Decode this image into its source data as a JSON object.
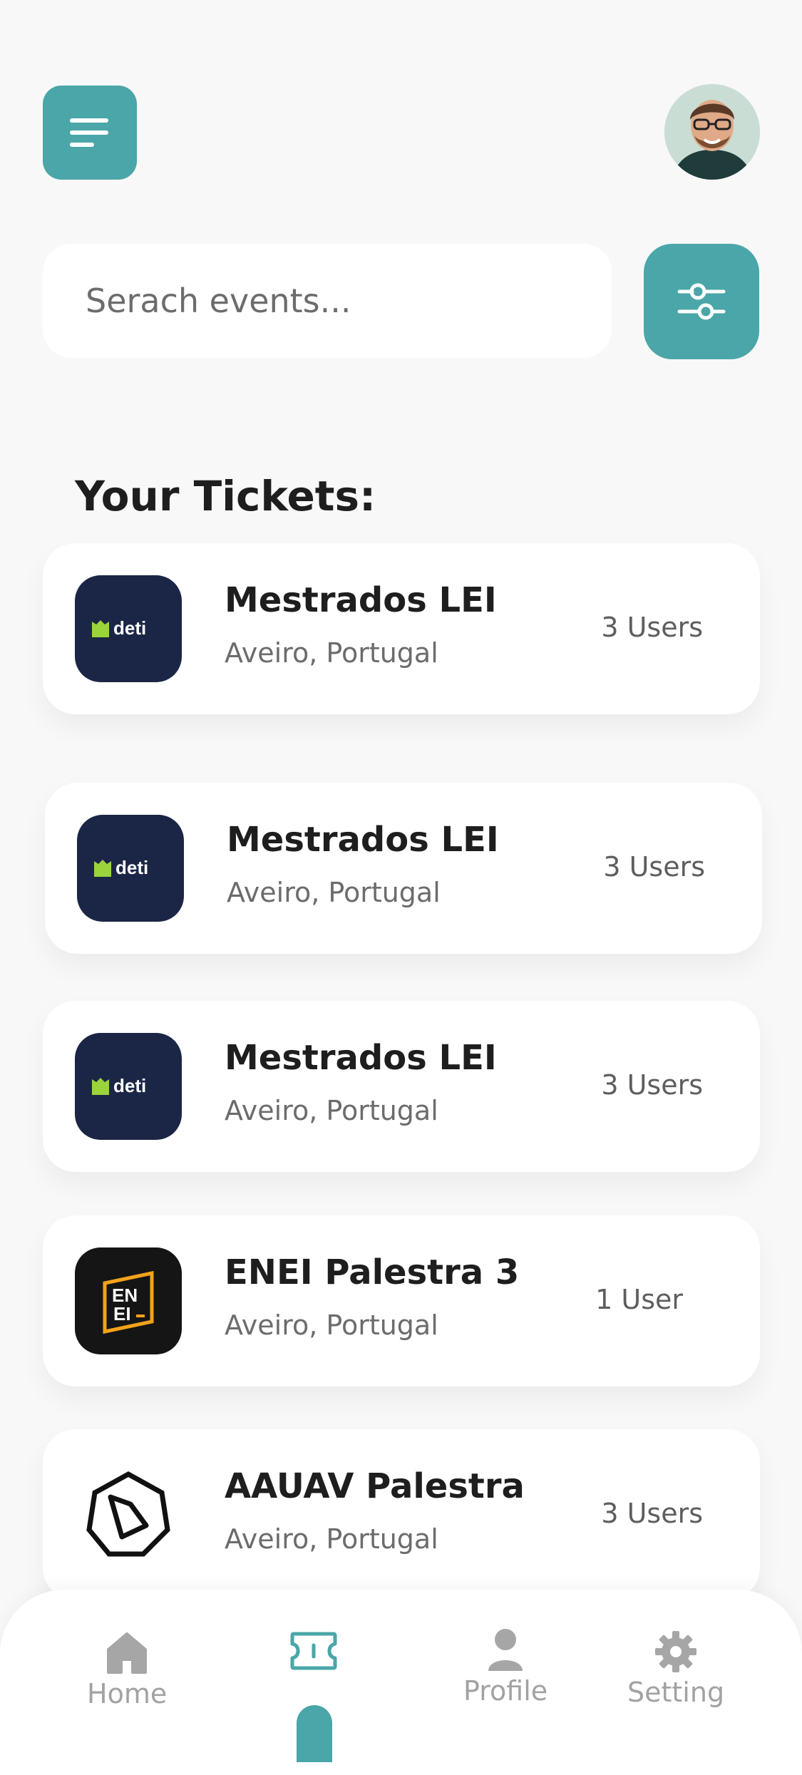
{
  "search": {
    "placeholder": "Serach events..."
  },
  "section": {
    "title": "Your Tickets:"
  },
  "colors": {
    "accent": "#4aa6a8",
    "deti_bg": "#1b2646",
    "deti_green": "#9ad43a",
    "enei_orange": "#f2a21b"
  },
  "tickets": [
    {
      "title": "Mestrados LEI",
      "location": "Aveiro, Portugal",
      "users": "3 Users",
      "logo": "deti-logo"
    },
    {
      "title": "Mestrados LEI",
      "location": "Aveiro, Portugal",
      "users": "3 Users",
      "logo": "deti-logo"
    },
    {
      "title": "Mestrados LEI",
      "location": "Aveiro, Portugal",
      "users": "3 Users",
      "logo": "deti-logo"
    },
    {
      "title": "ENEI Palestra 3",
      "location": "Aveiro, Portugal",
      "users": "1 User",
      "logo": "enei-logo"
    },
    {
      "title": "AAUAV Palestra",
      "location": "Aveiro, Portugal",
      "users": "3 Users",
      "logo": "aauav-logo"
    }
  ],
  "logos": {
    "deti": "deti",
    "enei_line1": "EN",
    "enei_line2": "EI"
  },
  "nav": {
    "home": "Home",
    "profile": "Profile",
    "setting": "Setting"
  }
}
